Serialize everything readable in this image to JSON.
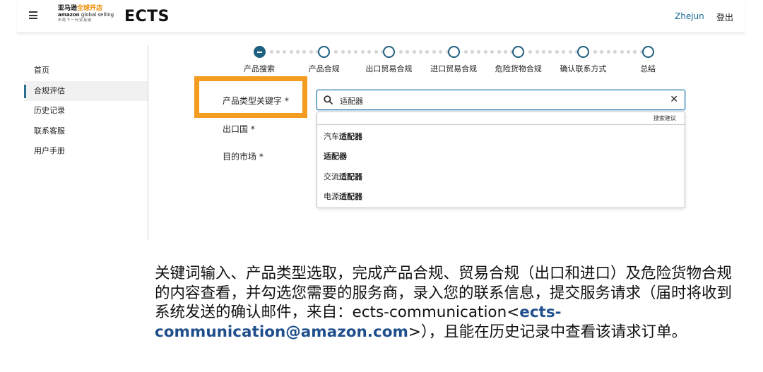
{
  "header": {
    "logo": {
      "line1_black": "亚马逊",
      "line1_orange": "全球开店",
      "line2_bold": "amazon",
      "line2_rest": " global selling",
      "line3": "布局下一代贸易链"
    },
    "app_title": "ECTS",
    "user_name": "Zhejun",
    "logout_label": "登出"
  },
  "sidebar": {
    "items": [
      {
        "label": "首页",
        "active": false
      },
      {
        "label": "合规评估",
        "active": true
      },
      {
        "label": "历史记录",
        "active": false
      },
      {
        "label": "联系客服",
        "active": false
      },
      {
        "label": "用户手册",
        "active": false
      }
    ]
  },
  "stepper": {
    "current_index": 0,
    "steps": [
      {
        "label": "产品搜索"
      },
      {
        "label": "产品合规"
      },
      {
        "label": "出口贸易合规"
      },
      {
        "label": "进口贸易合规"
      },
      {
        "label": "危险货物合规"
      },
      {
        "label": "确认联系方式"
      },
      {
        "label": "总结"
      }
    ]
  },
  "form": {
    "keyword_label": "产品类型关键字 *",
    "export_country_label": "出口国 *",
    "destination_label": "目的市场 *",
    "search_value": "适配器",
    "suggestions_header": "搜索建议",
    "suggestions": [
      {
        "prefix": "汽车",
        "match": "适配器"
      },
      {
        "prefix": "",
        "match": "适配器"
      },
      {
        "prefix": "交流",
        "match": "适配器"
      },
      {
        "prefix": "电源",
        "match": "适配器"
      }
    ]
  },
  "caption": {
    "text_main": "关键词输入、产品类型选取，完成产品合规、贸易合规（出口和进口）及危险货物合规的内容查看，并勾选您需要的服务商，录入您的联系信息，提交服务请求（届时将收到系统发送的确认邮件，来自：ects-communication<",
    "email": "ects-communication@amazon.com",
    "text_end": ">），且能在历史记录中查看该请求订单。"
  },
  "colors": {
    "accent": "#1f5f7f",
    "highlight": "#f39c1f",
    "link": "#1a6d9a",
    "email": "#1f4e8c"
  }
}
